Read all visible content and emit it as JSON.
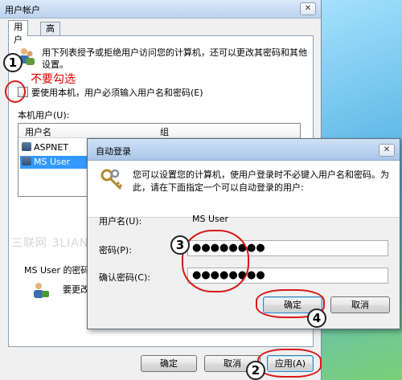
{
  "window": {
    "title": "用户帐户",
    "close_glyph": "✕"
  },
  "tabs": [
    {
      "label": "用户"
    },
    {
      "label": "高级"
    }
  ],
  "description": "用下列表授予或拒绝用户访问您的计算机，还可以更改其密码和其他设置。",
  "checkbox": {
    "label": "要使用本机，用户必须输入用户名和密码(E)",
    "checked": false
  },
  "local_users_label": "本机用户(U):",
  "list": {
    "columns": [
      "用户名",
      "组"
    ],
    "rows": [
      {
        "name": "ASPNET",
        "selected": false
      },
      {
        "name": "MS User",
        "selected": true
      }
    ]
  },
  "password_section": {
    "title": "MS User 的密码",
    "text": "要更改"
  },
  "watermark": "三联网 3LIAN.COM",
  "main_buttons": {
    "ok": "确定",
    "cancel": "取消",
    "apply": "应用(A)"
  },
  "dialog": {
    "title": "自动登录",
    "close_glyph": "✕",
    "description": "您可以设置您的计算机，使用户登录时不必键入用户名和密码。为此，请在下面指定一个可以自动登录的用户:",
    "username_label": "用户名(U):",
    "username_value": "MS User",
    "password_label": "密码(P):",
    "password_value": "●●●●●●●●",
    "confirm_label": "确认密码(C):",
    "confirm_value": "●●●●●●●●",
    "ok": "确定",
    "cancel": "取消"
  },
  "annotations": {
    "note": "不要勾选",
    "step1": "1",
    "step2": "2",
    "step3": "3",
    "step4": "4"
  }
}
